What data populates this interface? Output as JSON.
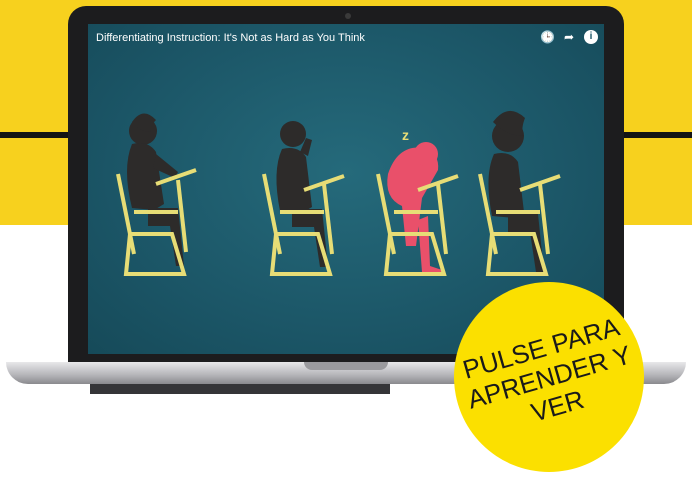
{
  "video": {
    "title": "Differentiating Instruction: It's Not as Hard as You Think",
    "icons": [
      "clock-icon",
      "share-icon",
      "info-icon"
    ]
  },
  "call_to_action": {
    "lines": [
      "PULSE PARA",
      "APRENDER Y",
      "VER"
    ]
  },
  "colors": {
    "brand_yellow": "#f7d11e",
    "screen_teal": "#1b5566",
    "highlight_pink": "#e9506a",
    "desk_yellow": "#e7dd76"
  }
}
